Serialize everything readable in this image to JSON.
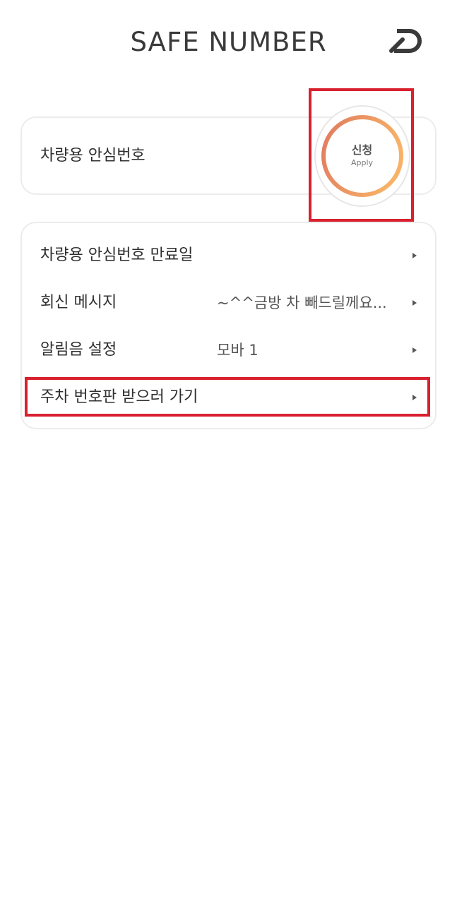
{
  "header": {
    "title": "SAFE NUMBER",
    "back_icon": "return-arrow-icon"
  },
  "safe_number_card": {
    "label": "차량용 안심번호",
    "apply_ko": "신청",
    "apply_en": "Apply",
    "ring_gradient": [
      "#e07a5f",
      "#f7b267"
    ]
  },
  "settings": {
    "rows": [
      {
        "label": "차량용 안심번호 만료일",
        "value": ""
      },
      {
        "label": "회신 메시지",
        "value": "~^^금방 차 빼드릴께요..."
      },
      {
        "label": "알림음 설정",
        "value": "모바 1"
      },
      {
        "label": "주차 번호판 받으러 가기",
        "value": ""
      }
    ]
  },
  "colors": {
    "highlight": "#d9202e",
    "card_border": "#ececec"
  }
}
